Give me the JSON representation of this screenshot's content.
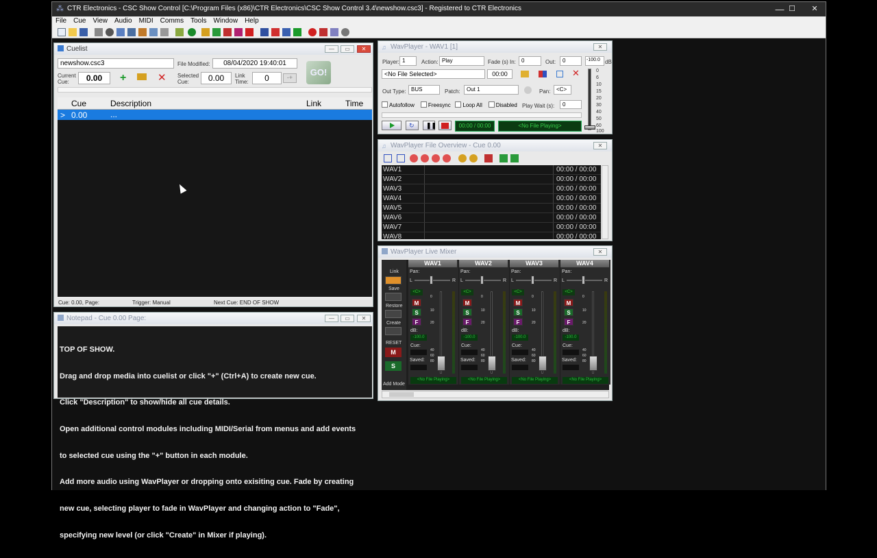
{
  "app": {
    "title": "CTR Electronics - CSC Show Control [C:\\Program Files (x86)\\CTR Electronics\\CSC Show Control 3.4\\newshow.csc3] - Registered to CTR Electronics",
    "minimize": "—",
    "maximize": "☐",
    "close": "✕"
  },
  "menu": [
    "File",
    "Cue",
    "View",
    "Audio",
    "MIDI",
    "Comms",
    "Tools",
    "Window",
    "Help"
  ],
  "cuelist": {
    "title": "Cuelist",
    "filename": "newshow.csc3",
    "file_modified_label": "File Modified:",
    "file_modified": "08/04/2020 19:40:01",
    "current_cue_label": "Current\nCue:",
    "current_cue": "0.00",
    "selected_cue_label": "Selected\nCue:",
    "selected_cue": "0.00",
    "link_time_label": "Link\nTime:",
    "link_time": "0",
    "go_label": "GO!",
    "columns": [
      "Cue",
      "Description",
      "Link",
      "Time"
    ],
    "rows": [
      {
        "marker": ">",
        "cue": "0.00",
        "desc": "..."
      }
    ],
    "status": {
      "cue": "Cue: 0.00, Page:",
      "trigger": "Trigger: Manual",
      "next": "Next Cue: END OF SHOW"
    }
  },
  "notepad": {
    "title": "Notepad - Cue 0.00 Page:",
    "lines": [
      "TOP OF SHOW.",
      "Drag and drop media into cuelist or click \"+\" (Ctrl+A) to create new cue.",
      "Click \"Description\" to show/hide all cue details.",
      "Open additional control modules including MIDI/Serial from menus and add events",
      "to selected cue using the \"+\" button in each module.",
      "Add more audio using WavPlayer or dropping onto exisiting cue. Fade by creating",
      "new cue, selecting player to fade in WavPlayer and changing action to \"Fade\",",
      "specifying new level (or click \"Create\" in Mixer if playing)."
    ]
  },
  "wavplayer": {
    "title": "WavPlayer - WAV1 [1]",
    "player_label": "Player:",
    "player": "1",
    "action_label": "Action:",
    "action": "Play",
    "fade_label": "Fade (s) In:",
    "fade_in": "0",
    "out_label": "Out:",
    "fade_out": "0",
    "level": "-100.0",
    "db_label": "dB",
    "file": "<No File Selected>",
    "file_time": "00:00",
    "out_type_label": "Out Type:",
    "out_type": "BUS",
    "patch_label": "Patch:",
    "patch": "Out 1",
    "pan_label": "Pan:",
    "pan": "<C>",
    "checks": [
      "Autofollow",
      "Freesync",
      "Loop All",
      "Disabled"
    ],
    "play_wait_label": "Play Wait (s):",
    "play_wait": "0",
    "time_display": "00:00 / 00:00",
    "status_display": "<No File Playing>",
    "scale": [
      "0",
      "6",
      "10",
      "15",
      "20",
      "30",
      "40",
      "50",
      "60",
      "100"
    ]
  },
  "overview": {
    "title": "WavPlayer File Overview - Cue 0.00",
    "rows": [
      {
        "name": "WAV1",
        "time": "00:00 / 00:00"
      },
      {
        "name": "WAV2",
        "time": "00:00 / 00:00"
      },
      {
        "name": "WAV3",
        "time": "00:00 / 00:00"
      },
      {
        "name": "WAV4",
        "time": "00:00 / 00:00"
      },
      {
        "name": "WAV5",
        "time": "00:00 / 00:00"
      },
      {
        "name": "WAV6",
        "time": "00:00 / 00:00"
      },
      {
        "name": "WAV7",
        "time": "00:00 / 00:00"
      },
      {
        "name": "WAV8",
        "time": "00:00 / 00:00"
      }
    ]
  },
  "mixer": {
    "title": "WavPlayer Live Mixer",
    "side": {
      "link": "Link",
      "save": "Save",
      "restore": "Restore",
      "create": "Create",
      "reset": "RESET",
      "m": "M",
      "s": "S",
      "add_mode": "Add Mode"
    },
    "channels": [
      {
        "name": "WAV1"
      },
      {
        "name": "WAV2"
      },
      {
        "name": "WAV3"
      },
      {
        "name": "WAV4"
      }
    ],
    "labels": {
      "pan": "Pan:",
      "l": "L",
      "r": "R",
      "c": "<C>",
      "m": "M",
      "s": "S",
      "f": "F",
      "db": "dB:",
      "db_value": "-100.0",
      "cue": "Cue:",
      "saved": "Saved:",
      "no_file": "<No File Playing>",
      "scale": [
        "0",
        "10",
        "20",
        "40",
        "60",
        "80"
      ]
    }
  }
}
